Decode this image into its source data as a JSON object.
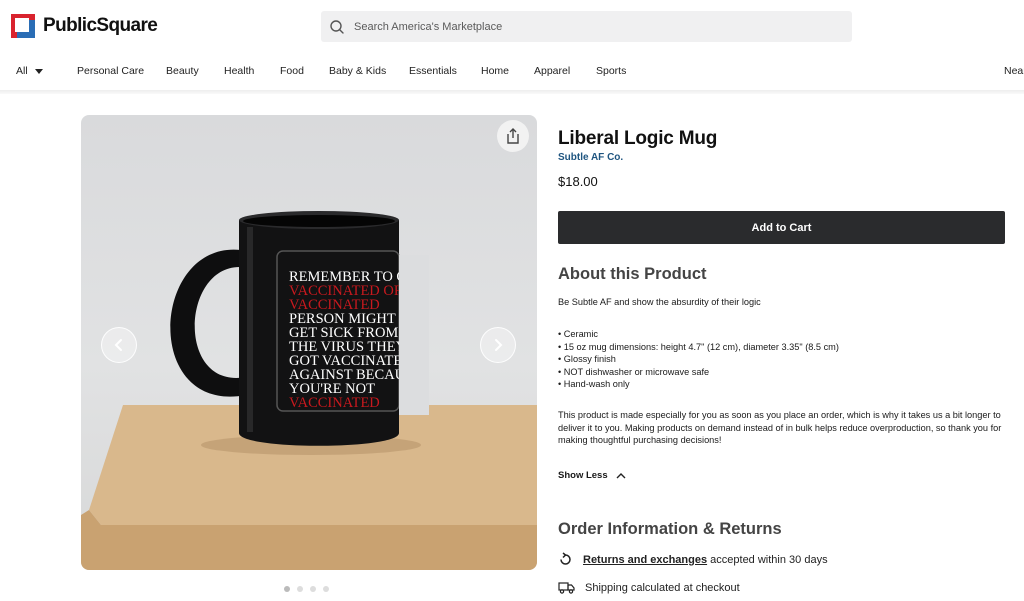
{
  "header": {
    "logo_text": "PublicSquare",
    "search_placeholder": "Search America's Marketplace"
  },
  "nav": {
    "all_label": "All",
    "items": [
      "Personal Care",
      "Beauty",
      "Health",
      "Food",
      "Baby & Kids",
      "Essentials",
      "Home",
      "Apparel",
      "Sports",
      "Near"
    ]
  },
  "gallery": {
    "image_count": 4,
    "active_index": 0,
    "mug_text_lines": [
      "REMEMBER TO GET",
      "VACCINATED OR",
      "VACCINATED",
      "PERSON MIGHT",
      "GET SICK FROM",
      "THE VIRUS THEY",
      "GOT VACCINATED",
      "AGAINST BECAUSE",
      "YOU'RE NOT",
      "VACCINATED"
    ],
    "colors": {
      "red_text": "#c8191e",
      "white_text": "#ffffff"
    }
  },
  "product": {
    "title": "Liberal Logic Mug",
    "brand": "Subtle AF Co.",
    "price": "$18.00",
    "add_to_cart": "Add to Cart"
  },
  "about": {
    "heading": "About this Product",
    "intro": "Be Subtle AF and show the absurdity of their logic",
    "bullets": [
      "• Ceramic",
      "• 15 oz mug dimensions: height 4.7\" (12 cm), diameter 3.35\" (8.5 cm)",
      "• Glossy finish",
      "• NOT dishwasher or microwave safe",
      "• Hand-wash only"
    ],
    "note": "This product is made especially for you as soon as you place an order, which is why it takes us a bit longer to deliver it to you. Making products on demand instead of in bulk helps reduce overproduction, so thank you for making thoughtful purchasing decisions!",
    "show_less": "Show Less"
  },
  "order_info": {
    "heading": "Order Information & Returns",
    "returns_link": "Returns and exchanges",
    "returns_text": "accepted within 30 days",
    "shipping_text": "Shipping calculated at checkout"
  },
  "colors": {
    "button_bg": "#2a2b2d",
    "brand_link": "#1f5580",
    "logo_red": "#d9232e",
    "logo_blue": "#2a6db5"
  }
}
